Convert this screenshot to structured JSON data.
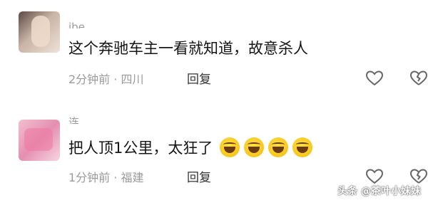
{
  "comments": [
    {
      "username": "ibe",
      "text": "这个奔驰车主一看就知道，故意杀人",
      "meta": "2分钟前 · 四川",
      "reply_label": "回复"
    },
    {
      "username": "连",
      "text": "把人顶1公里，太狂了",
      "emojis": [
        "laughing-crying-emoji",
        "laughing-crying-emoji",
        "laughing-crying-emoji",
        "laughing-crying-emoji"
      ],
      "meta": "1分钟前 · 福建",
      "reply_label": "回复"
    }
  ],
  "watermark": "头条 @茶叶小妹妹",
  "colors": {
    "text": "#151515",
    "meta": "#9a9a9a",
    "icon_stroke": "#666666",
    "emoji_yellow": "#f7c51a"
  },
  "icons": {
    "like": "heart-outline-icon",
    "dislike": "broken-heart-icon"
  }
}
